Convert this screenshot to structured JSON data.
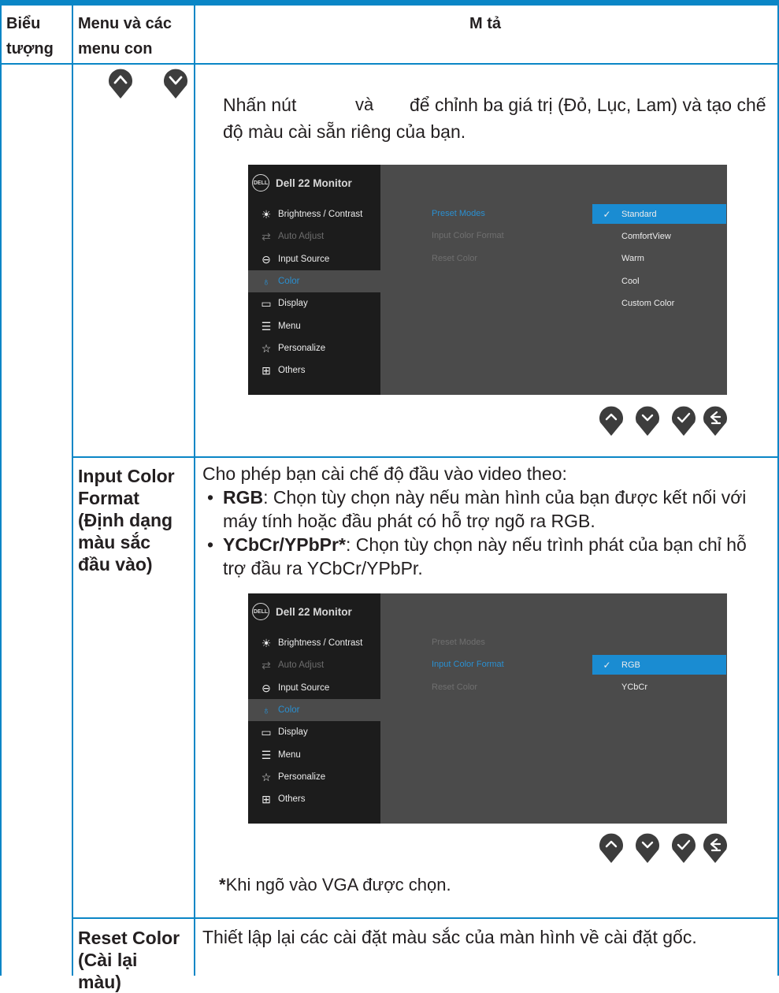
{
  "header": {
    "col1": [
      "Biểu",
      "tượng"
    ],
    "col2": [
      "Menu và các",
      "menu con"
    ],
    "col3": "M tả"
  },
  "row1": {
    "text_line1_pre": "Nhấn nút",
    "text_line1_mid": "và",
    "text_line1_post": "để chỉnh ba giá trị (Đỏ, Lục, Lam) và tạo chế",
    "text_line2": "độ màu cài sẵn riêng của bạn."
  },
  "osd_common": {
    "logo": "DELL",
    "title": "Dell 22 Monitor",
    "menu_items": [
      {
        "label": "Brightness / Contrast",
        "icon": "brightness-icon",
        "glyph": "☀",
        "state": "normal"
      },
      {
        "label": "Auto Adjust",
        "icon": "auto-adjust-icon",
        "glyph": "⇄",
        "state": "dim"
      },
      {
        "label": "Input Source",
        "icon": "input-source-icon",
        "glyph": "⊖",
        "state": "normal"
      },
      {
        "label": "Color",
        "icon": "color-icon",
        "glyph": "♁",
        "state": "active"
      },
      {
        "label": "Display",
        "icon": "display-icon",
        "glyph": "▭",
        "state": "normal"
      },
      {
        "label": "Menu",
        "icon": "menu-icon",
        "glyph": "☰",
        "state": "normal"
      },
      {
        "label": "Personalize",
        "icon": "star-icon",
        "glyph": "☆",
        "state": "normal"
      },
      {
        "label": "Others",
        "icon": "others-icon",
        "glyph": "⊞",
        "state": "normal"
      }
    ],
    "submenu": [
      "Preset Modes",
      "Input Color Format",
      "Reset Color"
    ]
  },
  "osd1": {
    "highlight_sub": 0,
    "options": [
      "Standard",
      "ComfortView",
      "Warm",
      "Cool",
      "Custom Color"
    ],
    "selected_option": 0
  },
  "osd2": {
    "highlight_sub": 1,
    "options": [
      "RGB",
      "YCbCr"
    ],
    "selected_option": 0
  },
  "buttons": [
    {
      "icon": "up-arrow-icon"
    },
    {
      "icon": "down-arrow-icon"
    },
    {
      "icon": "check-icon"
    },
    {
      "icon": "back-icon"
    }
  ],
  "row2": {
    "menu_name": [
      "Input Color",
      "Format",
      "(Định dạng",
      "màu sắc",
      "đầu vào)"
    ],
    "intro": "Cho phép bạn cài chế độ đầu vào video theo:",
    "bullet1_bold": "RGB",
    "bullet1_line1": ": Chọn tùy chọn này nếu màn hình của bạn được kết nối với",
    "bullet1_line2": "máy tính hoặc đầu phát có hỗ trợ ngõ ra RGB.",
    "bullet2_bold": "YCbCr/YPbPr*",
    "bullet2_line1": ": Chọn tùy chọn này nếu trình phát của bạn chỉ hỗ",
    "bullet2_line2": "trợ đầu ra YCbCr/YPbPr.",
    "footnote_star": "*",
    "footnote_text": "Khi ngõ vào VGA được chọn."
  },
  "row3": {
    "menu_name": [
      "Reset Color",
      "(Cài lại",
      "màu)"
    ],
    "text": "Thiết lập lại các cài đặt màu sắc của màn hình về cài đặt gốc."
  },
  "colors": {
    "accent_blue": "#0a86c6",
    "osd_highlight": "#1a8cd2",
    "button_fill": "#3d3d3d"
  }
}
